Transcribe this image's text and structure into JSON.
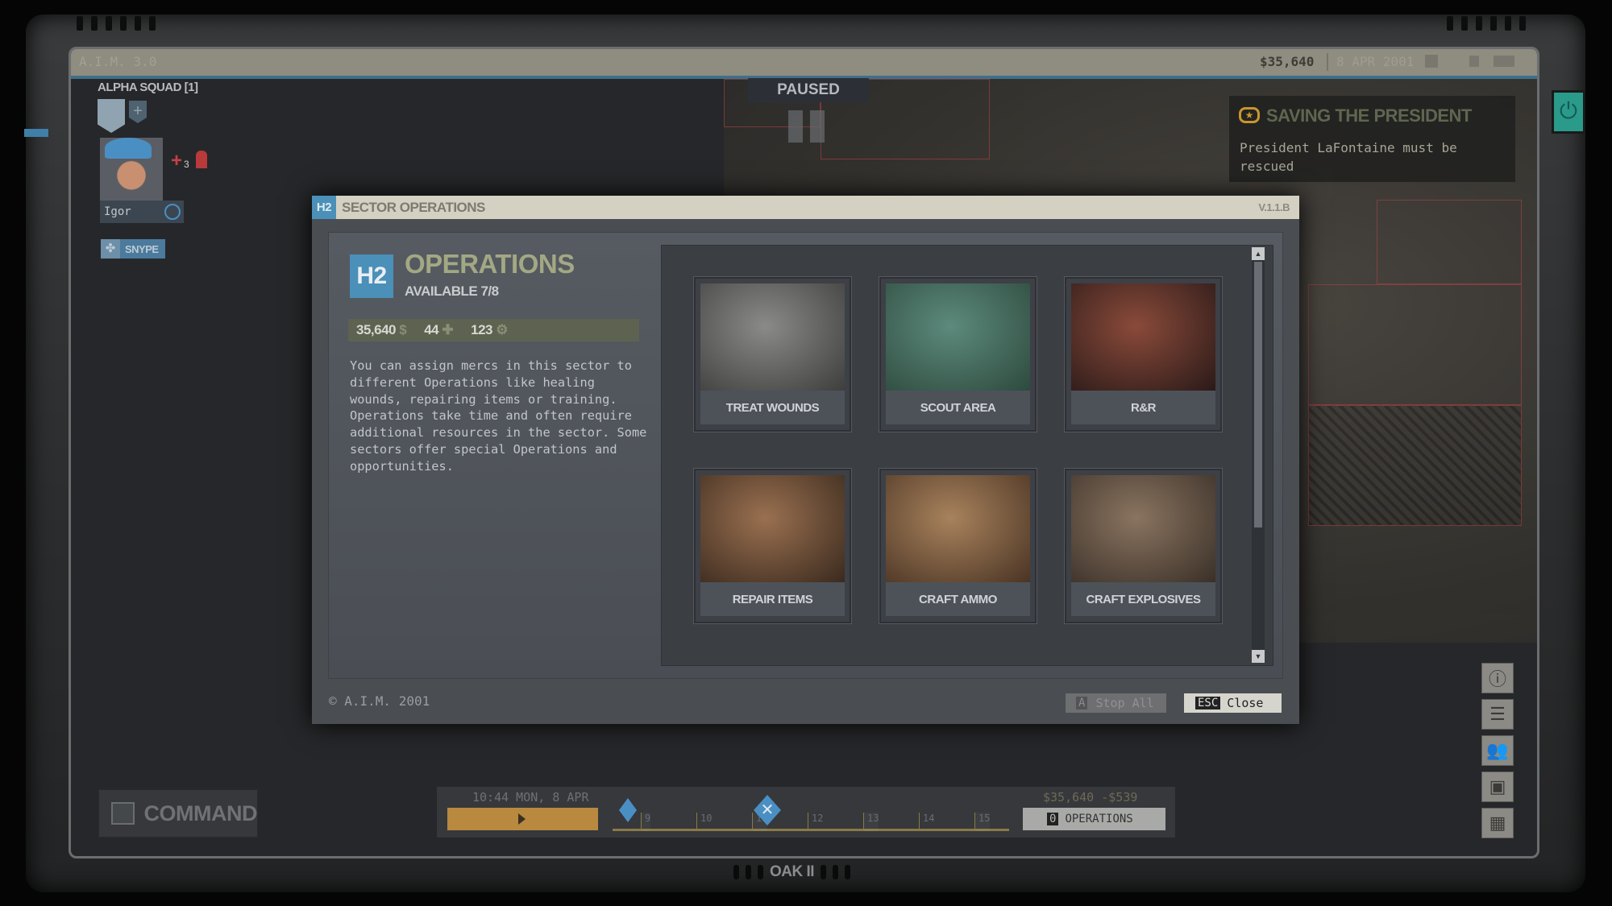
{
  "top_bar": {
    "app_label": "A.I.M. 3.0",
    "money": "$35,640",
    "date": "8 APR 2001"
  },
  "squad": {
    "name": "ALPHA SQUAD [1]",
    "merc_name": "Igor",
    "wound_count": "3",
    "snype_label": "SNYPE"
  },
  "paused_label": "PAUSED",
  "objective": {
    "title": "SAVING THE PRESIDENT",
    "text": "President LaFontaine must be rescued"
  },
  "dialog": {
    "sector_tag": "H2",
    "title": "SECTOR OPERATIONS",
    "version": "V.1.1.B",
    "header": {
      "sector": "H2",
      "heading": "OPERATIONS",
      "available": "AVAILABLE 7/8"
    },
    "resources": [
      {
        "value": "35,640",
        "icon": "dollar-icon"
      },
      {
        "value": "44",
        "icon": "meds-icon"
      },
      {
        "value": "123",
        "icon": "parts-icon"
      }
    ],
    "description": "You can assign mercs in this sector to different Operations like healing wounds, repairing items or training. Operations take time and often require additional resources in the sector. Some sectors offer special Operations and opportunities.",
    "operations": [
      {
        "label": "TREAT WOUNDS",
        "colors": [
          "#8a8a88",
          "#3e3e3c"
        ]
      },
      {
        "label": "SCOUT AREA",
        "colors": [
          "#5c8a7c",
          "#2e4a3e"
        ]
      },
      {
        "label": "R&R",
        "colors": [
          "#8a4a3a",
          "#2a1a18"
        ]
      },
      {
        "label": "REPAIR ITEMS",
        "colors": [
          "#9a7050",
          "#3a2a1e"
        ]
      },
      {
        "label": "CRAFT AMMO",
        "colors": [
          "#a8825c",
          "#4a3424"
        ]
      },
      {
        "label": "CRAFT EXPLOSIVES",
        "colors": [
          "#8a7460",
          "#3a3028"
        ]
      }
    ],
    "copyright": "© A.I.M. 2001",
    "stop_all": {
      "key": "A",
      "label": "Stop All"
    },
    "close": {
      "key": "ESC",
      "label": "Close"
    }
  },
  "command_label": "COMMAND",
  "timeline": {
    "time": "10:44 MON, 8 APR",
    "hours": [
      "9",
      "10",
      "11",
      "12",
      "13",
      "14",
      "15"
    ],
    "money": "$35,640 -$539",
    "operations_count": "0",
    "operations_label": "OPERATIONS"
  },
  "device_label": "OAK II",
  "colors": {
    "accent_blue": "#4a90b8",
    "olive": "#a3a884",
    "teal": "#2a9a8a",
    "gold": "#c8962e"
  }
}
